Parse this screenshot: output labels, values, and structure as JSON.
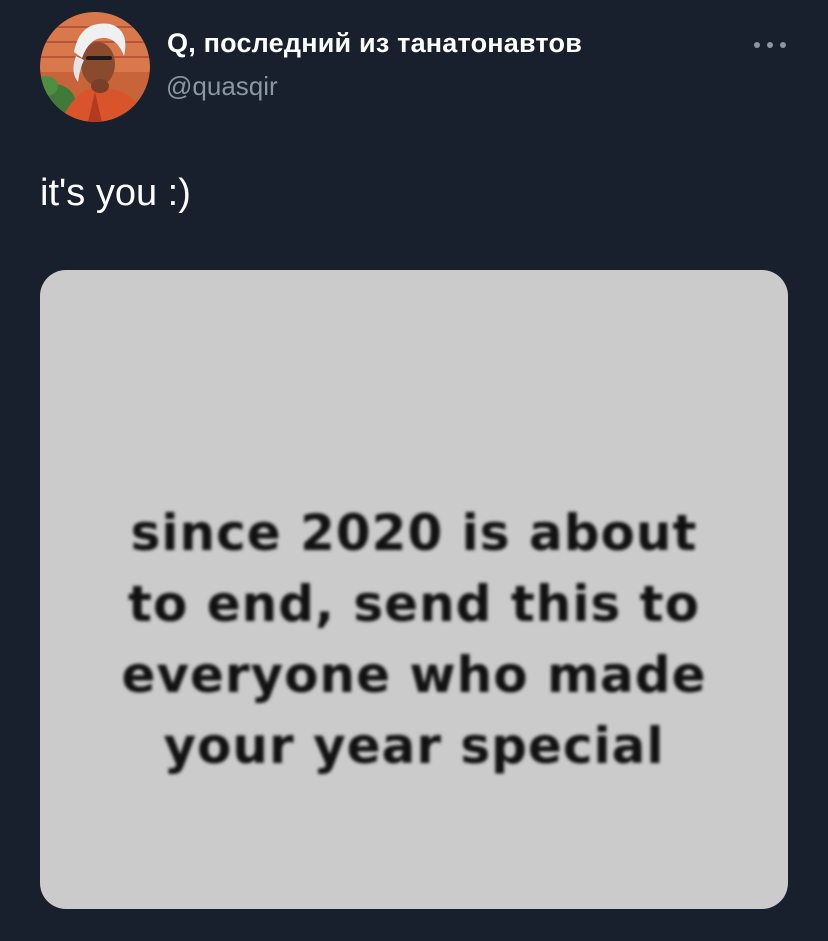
{
  "tweet": {
    "author": {
      "display_name": "Q, последний из танатонавтов",
      "handle": "@quasqir",
      "avatar_icon": "profile-avatar"
    },
    "more_icon": "more-options-icon",
    "text": "it's you :)",
    "media": {
      "lines": [
        "since 2020 is about",
        "to end, send this to",
        "everyone who made",
        "your year special"
      ]
    }
  },
  "colors": {
    "background": "#17202c",
    "text_primary": "#ffffff",
    "text_secondary": "#8a96a3",
    "media_background": "#cbcbcb"
  }
}
